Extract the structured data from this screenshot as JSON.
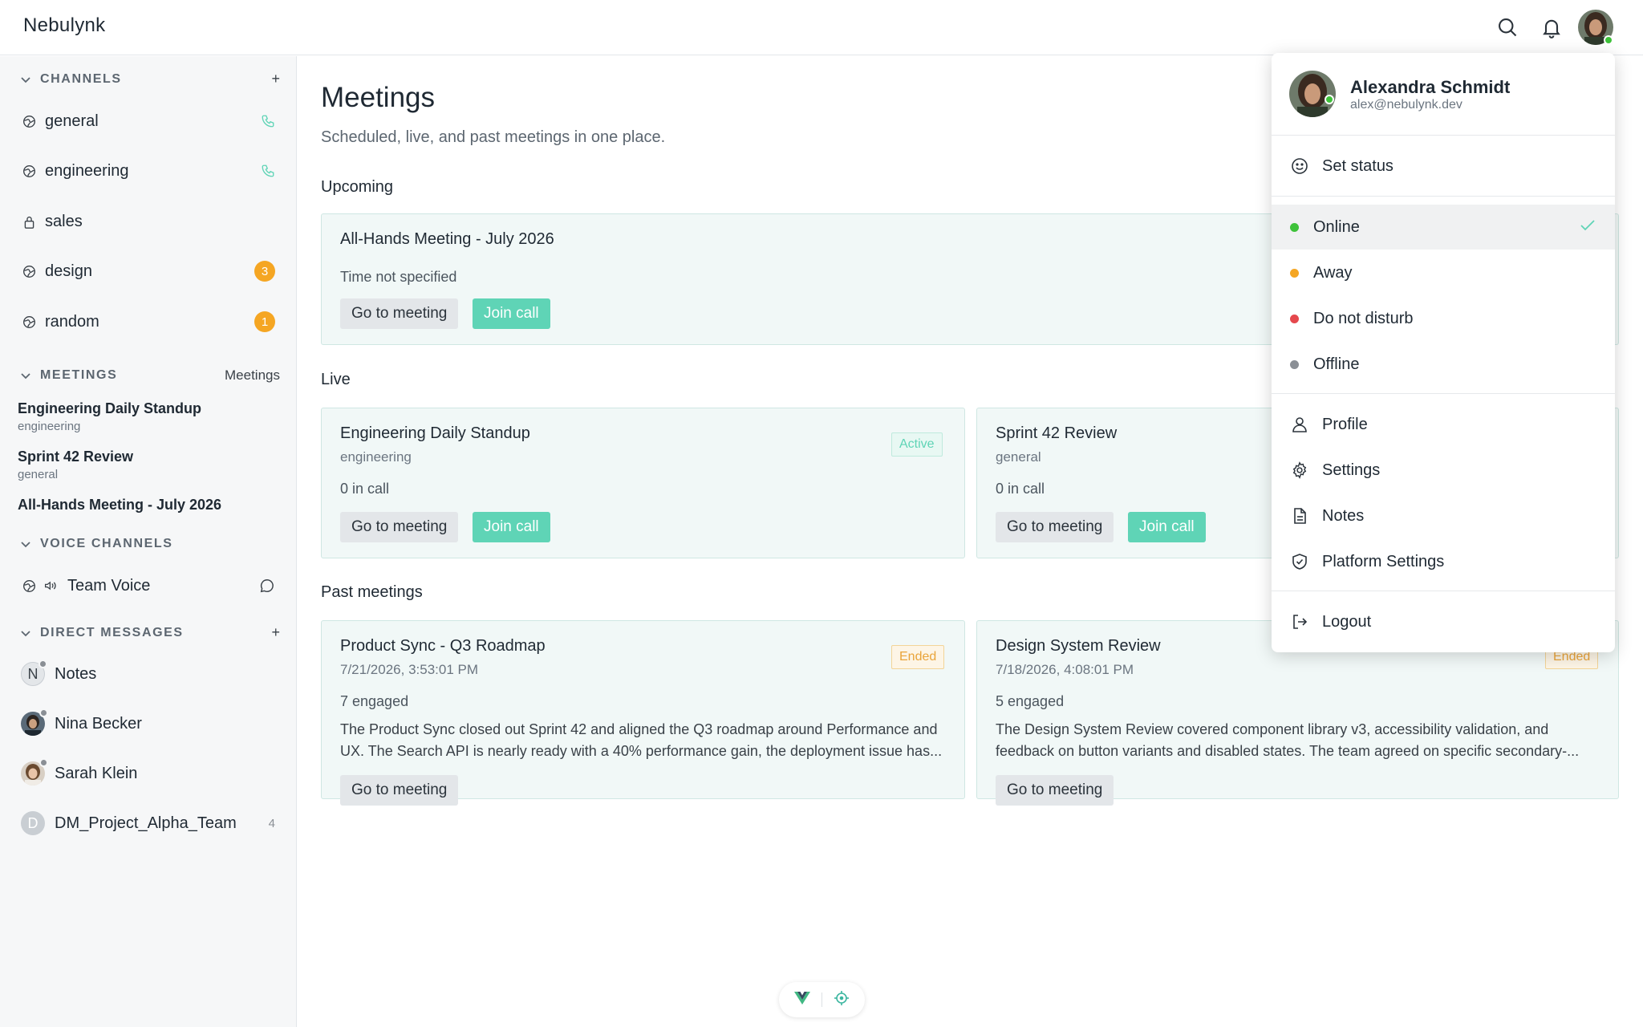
{
  "app": {
    "brand": "Nebulynk"
  },
  "colors": {
    "accent": "#5fd4b6",
    "badge": "#f5a623",
    "online": "#3ec23a",
    "away": "#f5a623",
    "dnd": "#e5484d",
    "offline": "#8a8f95"
  },
  "sidebar": {
    "channels_header": "CHANNELS",
    "channels_add": "+",
    "channels": [
      {
        "name": "general",
        "icon": "globe-icon",
        "trail": "phone-icon"
      },
      {
        "name": "engineering",
        "icon": "globe-icon",
        "trail": "phone-icon"
      },
      {
        "name": "sales",
        "icon": "lock-icon"
      },
      {
        "name": "design",
        "icon": "globe-icon",
        "badge": "3"
      },
      {
        "name": "random",
        "icon": "globe-icon",
        "badge": "1"
      }
    ],
    "meetings_header": "MEETINGS",
    "meetings_link": "Meetings",
    "meetings": [
      {
        "title": "Engineering Daily Standup",
        "channel": "engineering"
      },
      {
        "title": "Sprint 42 Review",
        "channel": "general"
      },
      {
        "title": "All-Hands Meeting - July 2026"
      }
    ],
    "voice_header": "VOICE CHANNELS",
    "voice": [
      {
        "name": "Team Voice",
        "icon": "speaker-icon",
        "trail": "chat-bubble-icon"
      }
    ],
    "dm_header": "DIRECT MESSAGES",
    "dm_add": "+",
    "dms": [
      {
        "name": "Notes",
        "initial": "N"
      },
      {
        "name": "Nina Becker"
      },
      {
        "name": "Sarah Klein"
      },
      {
        "name": "DM_Project_Alpha_Team",
        "initial": "D",
        "count": "4"
      }
    ]
  },
  "main": {
    "title": "Meetings",
    "subtitle": "Scheduled, live, and past meetings in one place.",
    "upcoming_title": "Upcoming",
    "upcoming": {
      "title": "All-Hands Meeting - July 2026",
      "time": "Time not specified",
      "goto": "Go to meeting",
      "join": "Join call"
    },
    "live_title": "Live",
    "live": [
      {
        "title": "Engineering Daily Standup",
        "channel": "engineering",
        "status": "Active",
        "count": "0 in call",
        "goto": "Go to meeting",
        "join": "Join call"
      },
      {
        "title": "Sprint 42 Review",
        "channel": "general",
        "count": "0 in call",
        "goto": "Go to meeting",
        "join": "Join call"
      }
    ],
    "past_title": "Past meetings",
    "past": [
      {
        "title": "Product Sync - Q3 Roadmap",
        "date": "7/21/2026, 3:53:01 PM",
        "status": "Ended",
        "engaged": "7 engaged",
        "summary": "The Product Sync closed out Sprint 42 and aligned the Q3 roadmap around Performance and UX. The Search API is nearly ready with a 40% performance gain, the deployment issue has...",
        "goto": "Go to meeting"
      },
      {
        "title": "Design System Review",
        "date": "7/18/2026, 4:08:01 PM",
        "status": "Ended",
        "engaged": "5 engaged",
        "summary": "The Design System Review covered component library v3, accessibility validation, and feedback on button variants and disabled states. The team agreed on specific secondary-...",
        "goto": "Go to meeting"
      }
    ]
  },
  "user_menu": {
    "name": "Alexandra Schmidt",
    "email": "alex@nebulynk.dev",
    "set_status": "Set status",
    "statuses": [
      {
        "label": "Online",
        "selected": true
      },
      {
        "label": "Away"
      },
      {
        "label": "Do not disturb"
      },
      {
        "label": "Offline"
      }
    ],
    "items": [
      {
        "label": "Profile",
        "icon": "person-icon"
      },
      {
        "label": "Settings",
        "icon": "gear-icon"
      },
      {
        "label": "Notes",
        "icon": "document-icon"
      },
      {
        "label": "Platform Settings",
        "icon": "shield-icon"
      }
    ],
    "logout": "Logout"
  }
}
